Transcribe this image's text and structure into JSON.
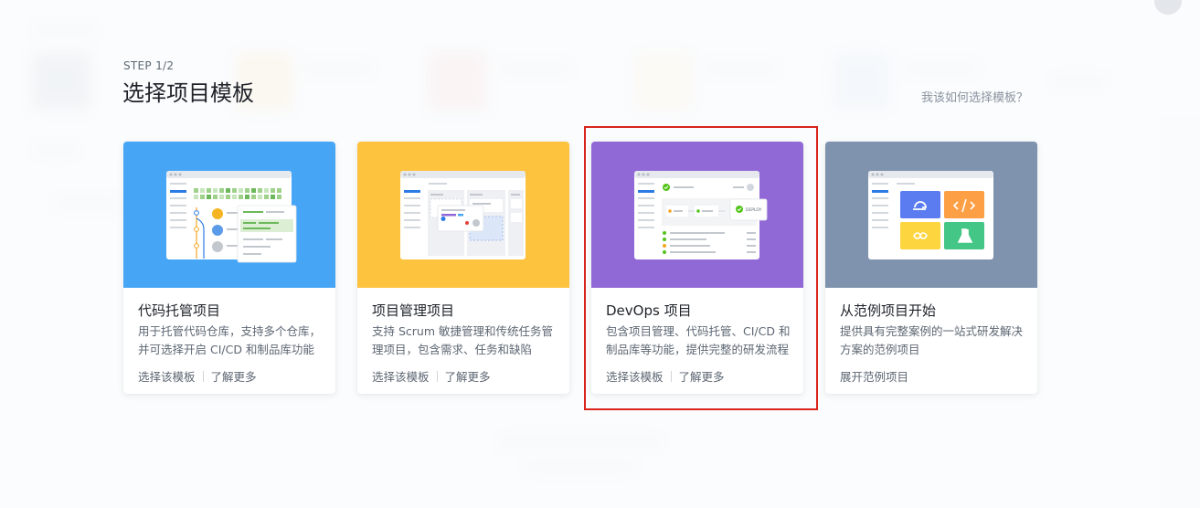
{
  "header": {
    "step": "STEP 1/2",
    "title": "选择项目模板",
    "help_link": "我该如何选择模板？"
  },
  "templates": [
    {
      "title": "代码托管项目",
      "desc": "用于托管代码仓库，支持多个仓库，并可选择开启 CI/CD 和制品库功能",
      "actions": [
        "选择该模板",
        "了解更多"
      ],
      "color": "#46a6f5"
    },
    {
      "title": "项目管理项目",
      "desc": "支持 Scrum 敏捷管理和传统任务管理项目，包含需求、任务和缺陷",
      "actions": [
        "选择该模板",
        "了解更多"
      ],
      "color": "#fdc33f"
    },
    {
      "title": "DevOps 项目",
      "desc": "包含项目管理、代码托管、CI/CD 和制品库等功能，提供完整的研发流程",
      "actions": [
        "选择该模板",
        "了解更多"
      ],
      "color": "#9169d6"
    },
    {
      "title": "从范例项目开始",
      "desc": "提供具有完整案例的一站式研发解决方案的范例项目",
      "actions": [
        "展开范例项目"
      ],
      "color": "#7f93ae"
    }
  ],
  "illustration": {
    "deploy_label": "DEPLOY"
  },
  "colors": {
    "highlight": "#d9231d"
  }
}
